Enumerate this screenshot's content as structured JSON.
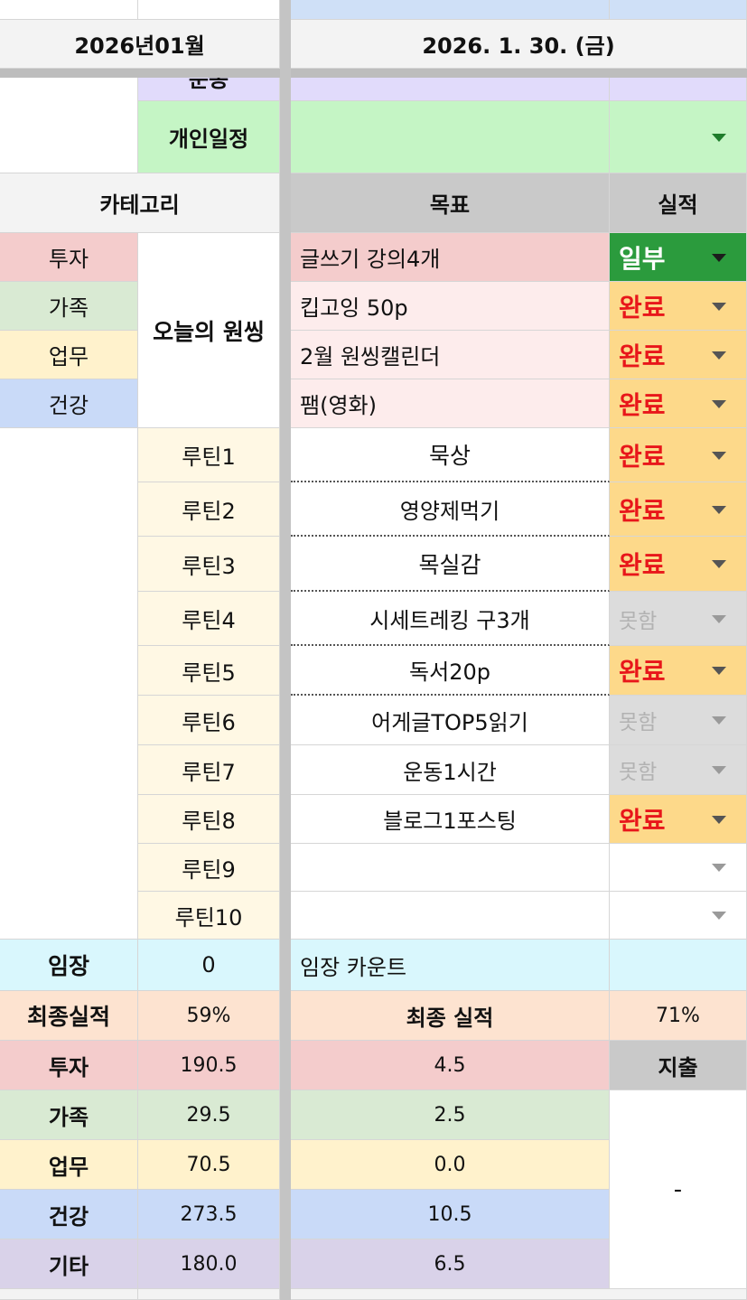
{
  "header": {
    "month": "2026년01월",
    "date": "2026. 1. 30. (금)"
  },
  "top_rows": {
    "exercise_label": "운동",
    "personal_label": "개인일정"
  },
  "table_header": {
    "category": "카테고리",
    "goal": "목표",
    "result": "실적"
  },
  "winning": {
    "label": "오늘의 원씽",
    "categories": [
      "투자",
      "가족",
      "업무",
      "건강"
    ],
    "goals": [
      "글쓰기 강의4개",
      "킵고잉 50p",
      "2월 원씽캘린더",
      "팸(영화)"
    ],
    "results": [
      "일부",
      "완료",
      "완료",
      "완료"
    ]
  },
  "routines": {
    "labels": [
      "루틴1",
      "루틴2",
      "루틴3",
      "루틴4",
      "루틴5",
      "루틴6",
      "루틴7",
      "루틴8",
      "루틴9",
      "루틴10"
    ],
    "goals": [
      "묵상",
      "영양제먹기",
      "목실감",
      "시세트레킹 구3개",
      "독서20p",
      "어게글TOP5읽기",
      "운동1시간",
      "블로그1포스팅",
      "",
      ""
    ],
    "results": [
      "완료",
      "완료",
      "완료",
      "못함",
      "완료",
      "못함",
      "못함",
      "완료",
      "",
      ""
    ]
  },
  "stamp": {
    "label": "임장",
    "count": "0",
    "count_label": "임장 카운트"
  },
  "final": {
    "label": "최종실적",
    "value": "59%",
    "label2": "최종 실적",
    "value2": "71%"
  },
  "summary": {
    "rows": [
      {
        "category": "투자",
        "total": "190.5",
        "today": "4.5"
      },
      {
        "category": "가족",
        "total": "29.5",
        "today": "2.5"
      },
      {
        "category": "업무",
        "total": "70.5",
        "today": "0.0"
      },
      {
        "category": "건강",
        "total": "273.5",
        "today": "10.5"
      },
      {
        "category": "기타",
        "total": "180.0",
        "today": "6.5"
      }
    ],
    "expense_label": "지출",
    "expense_value": "-"
  },
  "colors": {
    "invest": "#f4cccc",
    "family": "#d9ead3",
    "work": "#fff2cc",
    "health": "#c9daf8",
    "etc": "#d9d2e9",
    "personal": "#c5f5c5",
    "exercise": "#e1dbfb",
    "routine_label": "#fff8e4",
    "done": "#fdd98a",
    "partial": "#2b9b3d",
    "missed": "#dcdcdc",
    "stamp": "#d9f7fd",
    "final": "#fde3d0",
    "header_gray": "#c9c9c9"
  }
}
